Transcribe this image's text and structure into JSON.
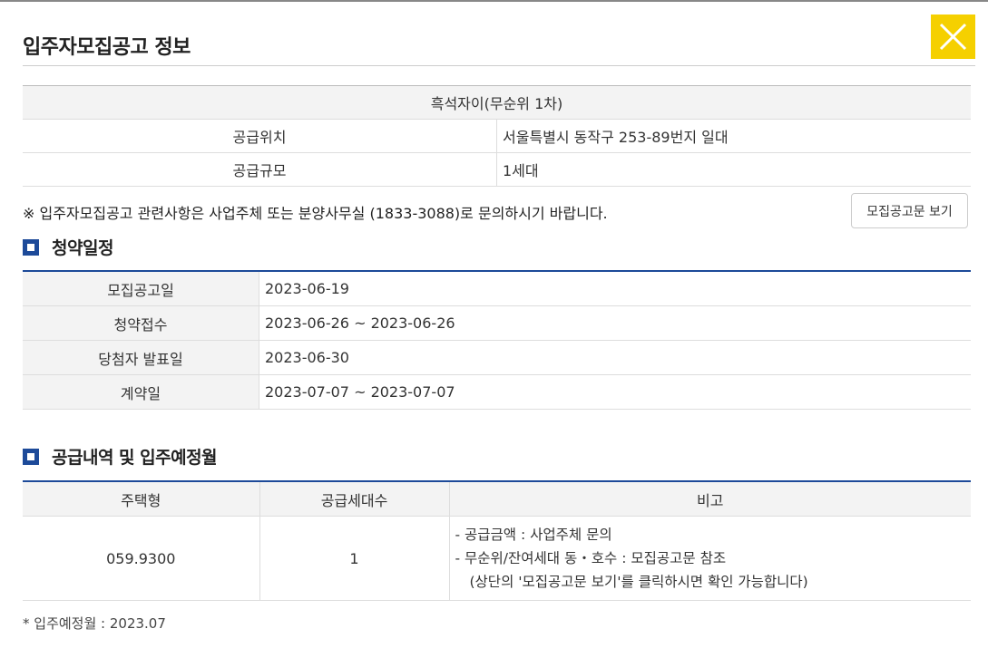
{
  "window": {
    "title": "입주자모집공고 정보"
  },
  "info": {
    "complex_name": "흑석자이(무순위 1차)",
    "rows": [
      {
        "label": "공급위치",
        "value": "서울특별시 동작구 253-89번지 일대"
      },
      {
        "label": "공급규모",
        "value": "1세대"
      }
    ]
  },
  "notice": "※ 입주자모집공고 관련사항은 사업주체 또는 분양사무실 (1833-3088)로 문의하시기 바랍니다.",
  "view_notice_button": "모집공고문 보기",
  "schedule": {
    "heading": "청약일정",
    "rows": [
      {
        "label": "모집공고일",
        "value": "2023-06-19"
      },
      {
        "label": "청약접수",
        "value": "2023-06-26 ~ 2023-06-26"
      },
      {
        "label": "당첨자 발표일",
        "value": "2023-06-30"
      },
      {
        "label": "계약일",
        "value": "2023-07-07 ~ 2023-07-07"
      }
    ]
  },
  "supply": {
    "heading": "공급내역 및 입주예정월",
    "columns": [
      "주택형",
      "공급세대수",
      "비고"
    ],
    "rows": [
      {
        "type": "059.9300",
        "units": "1",
        "notes": [
          "-  공급금액 : 사업주체 문의",
          "-  무순위/잔여세대 동・호수 : 모집공고문 참조",
          "(상단의 '모집공고문 보기'를 클릭하시면 확인 가능합니다)"
        ]
      }
    ]
  },
  "footnote": "* 입주예정월 : 2023.07",
  "colors": {
    "accent": "#1d4a99",
    "close_bg": "#f5d000"
  },
  "icons": {
    "close": "close-icon",
    "section": "square-bullet-icon"
  }
}
